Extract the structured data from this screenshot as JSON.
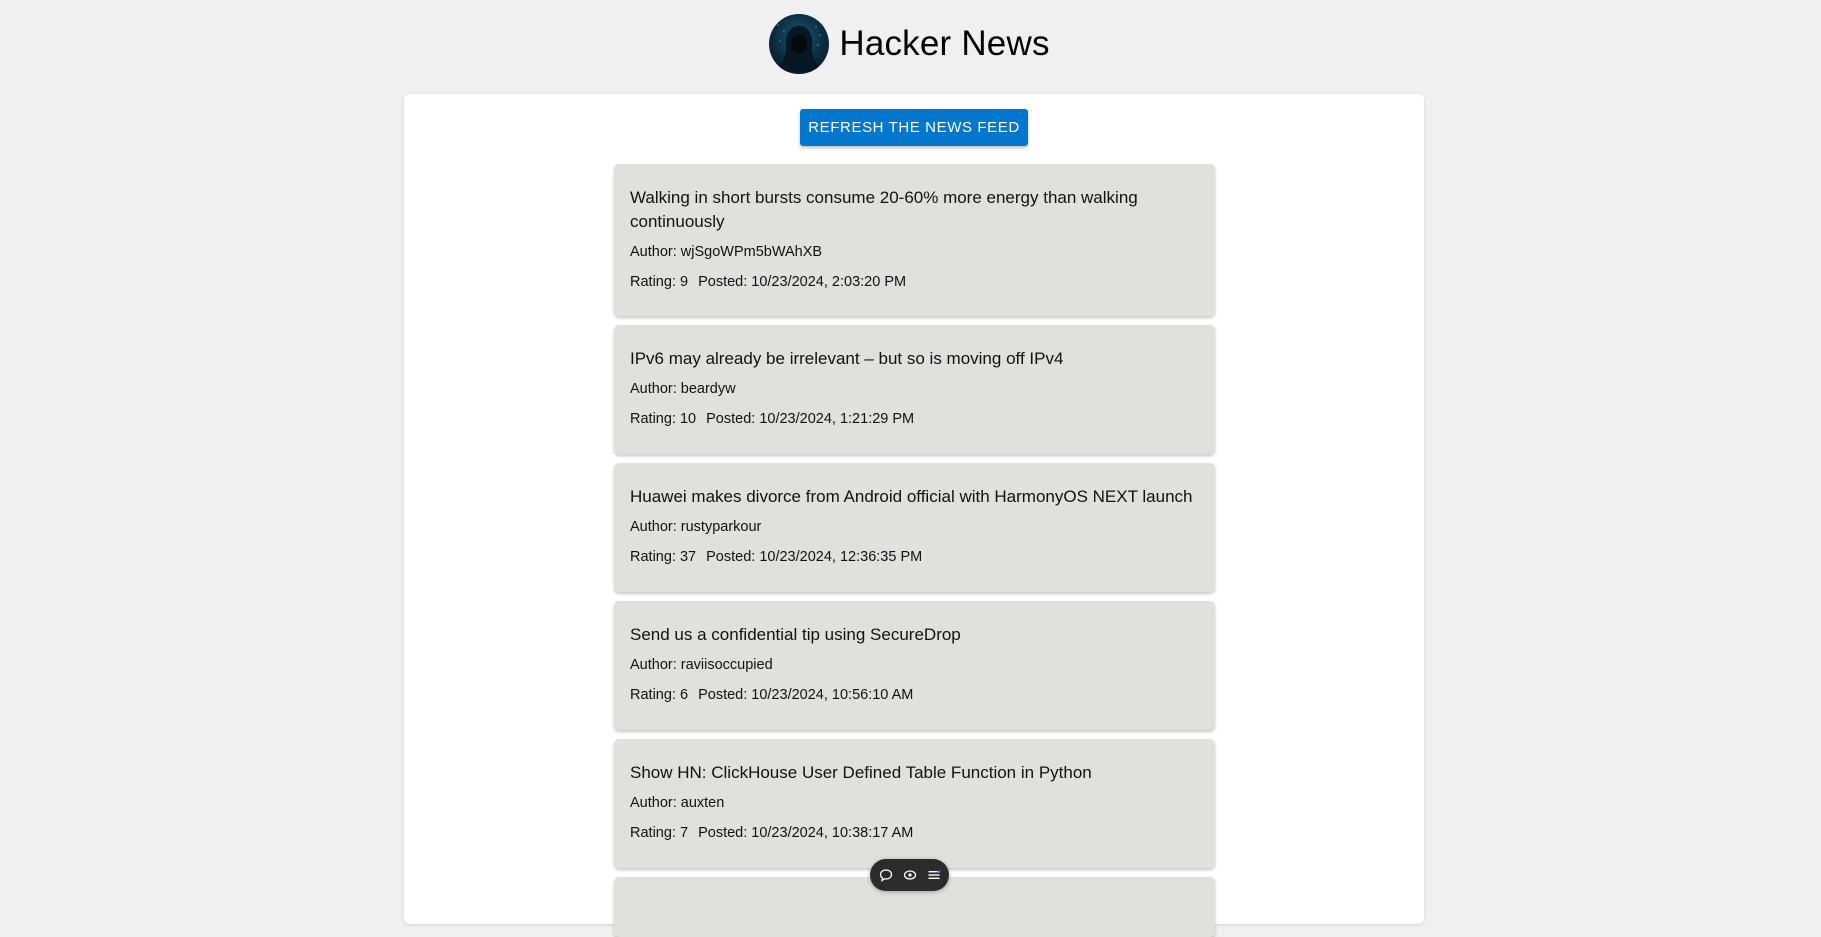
{
  "header": {
    "title": "Hacker News",
    "logo_icon": "hooded-hacker-avatar-icon"
  },
  "toolbar": {
    "refresh_label": "REFRESH THE NEWS FEED"
  },
  "stories": [
    {
      "title": "Walking in short bursts consume 20-60% more energy than walking continuously",
      "author": "Author: wjSgoWPm5bWAhXB",
      "rating": "Rating: 9",
      "posted": "Posted: 10/23/2024, 2:03:20 PM"
    },
    {
      "title": "IPv6 may already be irrelevant – but so is moving off IPv4",
      "author": "Author: beardyw",
      "rating": "Rating: 10",
      "posted": "Posted: 10/23/2024, 1:21:29 PM"
    },
    {
      "title": "Huawei makes divorce from Android official with HarmonyOS NEXT launch",
      "author": "Author: rustyparkour",
      "rating": "Rating: 37",
      "posted": "Posted: 10/23/2024, 12:36:35 PM"
    },
    {
      "title": "Send us a confidential tip using SecureDrop",
      "author": "Author: raviisoccupied",
      "rating": "Rating: 6",
      "posted": "Posted: 10/23/2024, 10:56:10 AM"
    },
    {
      "title": "Show HN: ClickHouse User Defined Table Function in Python",
      "author": "Author: auxten",
      "rating": "Rating: 7",
      "posted": "Posted: 10/23/2024, 10:38:17 AM"
    }
  ],
  "floating_toolbar": {
    "icons": [
      "comment-icon",
      "eye-icon",
      "list-icon"
    ]
  }
}
